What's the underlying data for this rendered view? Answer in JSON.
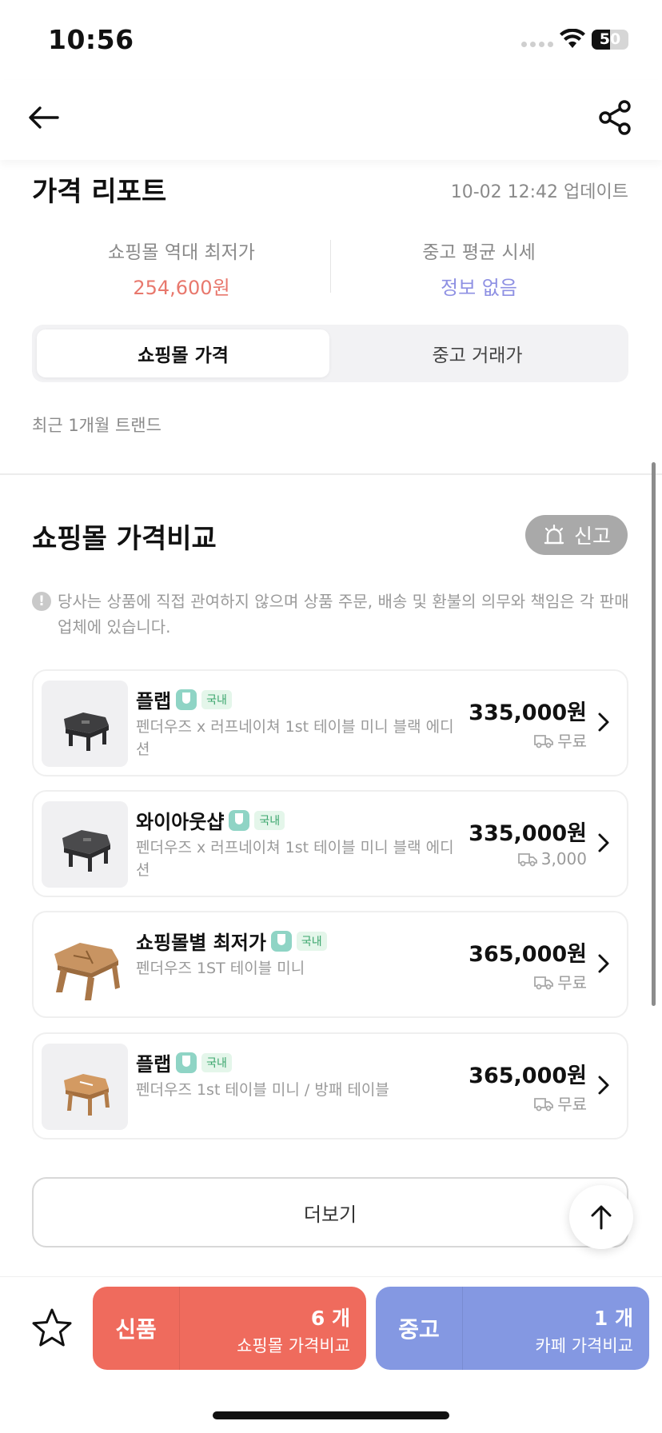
{
  "status_bar": {
    "time": "10:56",
    "battery": "50",
    "battery_level": 0.5
  },
  "header": {
    "back_icon": "arrow-left-icon",
    "share_icon": "share-icon"
  },
  "price_report": {
    "title": "가격 리포트",
    "updated": "10-02 12:42 업데이트",
    "lowest_label": "쇼핑몰 역대 최저가",
    "lowest_value": "254,600원",
    "used_label": "중고 평균 시세",
    "used_value": "정보 없음",
    "tabs": [
      "쇼핑몰 가격",
      "중고 거래가"
    ],
    "active_tab": "쇼핑몰 가격",
    "trend_label": "최근 1개월 트랜드"
  },
  "comparison": {
    "title": "쇼핑몰 가격비교",
    "report_button": "신고",
    "notice": "당사는 상품에 직접 관여하지 않으며 상품 주문, 배송 및 환불의 의무와 책임은 각 판매업체에 있습니다.",
    "items": [
      {
        "shop": "플랩",
        "badge": "국내",
        "desc": "펜더우즈 x 러프네이쳐 1st 테이블 미니 블랙 에디션",
        "price": "335,000원",
        "shipping": "무료"
      },
      {
        "shop": "와이아웃샵",
        "badge": "국내",
        "desc": "펜더우즈 x 러프네이쳐 1st 테이블 미니 블랙 에디션",
        "price": "335,000원",
        "shipping": "3,000"
      },
      {
        "shop": "쇼핑몰별 최저가",
        "badge": "국내",
        "desc": "펜더우즈 1ST 테이블 미니",
        "price": "365,000원",
        "shipping": "무료"
      },
      {
        "shop": "플랩",
        "badge": "국내",
        "desc": "펜더우즈 1st 테이블 미니 / 방패 테이블",
        "price": "365,000원",
        "shipping": "무료"
      }
    ],
    "more_button": "더보기"
  },
  "bottom_bar": {
    "new": {
      "label": "신품",
      "count": "6 개",
      "sub": "쇼핑몰 가격비교"
    },
    "used": {
      "label": "중고",
      "count": "1 개",
      "sub": "카페 가격비교"
    }
  },
  "colors": {
    "accent_red": "#ef6b5d",
    "accent_blue": "#8498e2",
    "lowest_price": "#e8786d",
    "used_price": "#8e90e3"
  }
}
